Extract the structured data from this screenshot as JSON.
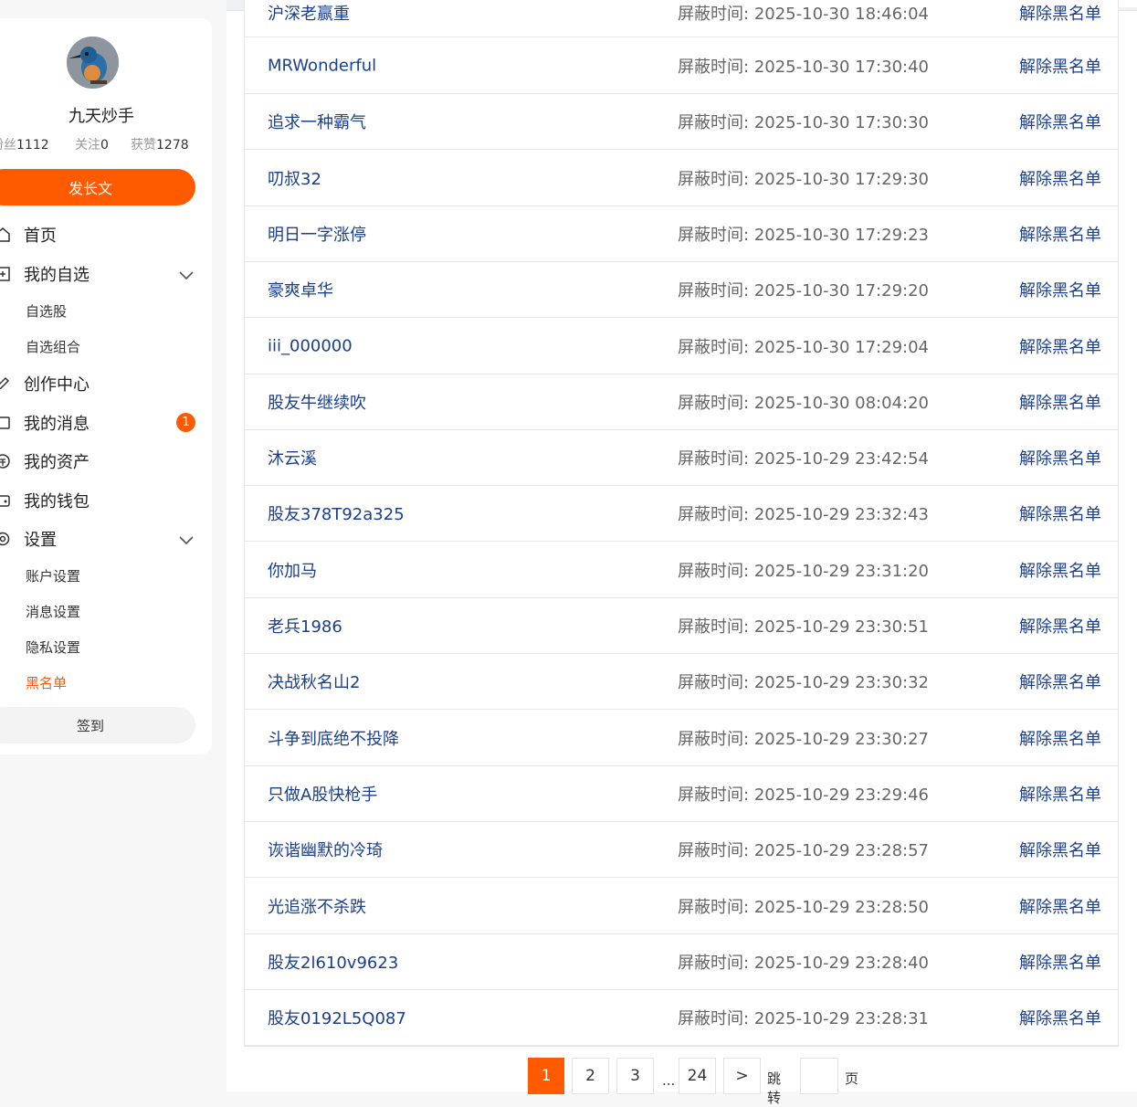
{
  "profile": {
    "name": "九天炒手",
    "fans_label": "粉丝",
    "fans": "1112",
    "follow_label": "关注",
    "follow": "0",
    "likes_label": "获赞",
    "likes": "1278"
  },
  "sidebar": {
    "publish_label": "发长文",
    "home": "首页",
    "watchlist": "我的自选",
    "watchlist_sub": [
      "自选股",
      "自选组合"
    ],
    "creator": "创作中心",
    "messages": "我的消息",
    "messages_badge": "1",
    "assets": "我的资产",
    "wallet": "我的钱包",
    "settings": "设置",
    "settings_sub": [
      "账户设置",
      "消息设置",
      "隐私设置",
      "黑名单"
    ],
    "checkin_label": "签到"
  },
  "blacklist": {
    "time_label": "屏蔽时间:",
    "action_label": "解除黑名单",
    "partial_top": {
      "name": "沪深老赢重",
      "time": "2025-10-30 18:46:04"
    },
    "rows": [
      {
        "name": "MRWonderful",
        "time": "2025-10-30 17:30:40"
      },
      {
        "name": "追求一种霸气",
        "time": "2025-10-30 17:30:30"
      },
      {
        "name": "叨叔32",
        "time": "2025-10-30 17:29:30"
      },
      {
        "name": "明日一字涨停",
        "time": "2025-10-30 17:29:23"
      },
      {
        "name": "豪爽卓华",
        "time": "2025-10-30 17:29:20"
      },
      {
        "name": "iii_000000",
        "time": "2025-10-30 17:29:04"
      },
      {
        "name": "股友牛继续吹",
        "time": "2025-10-30 08:04:20"
      },
      {
        "name": "沐云溪",
        "time": "2025-10-29 23:42:54"
      },
      {
        "name": "股友378T92a325",
        "time": "2025-10-29 23:32:43"
      },
      {
        "name": "你加马",
        "time": "2025-10-29 23:31:20"
      },
      {
        "name": "老兵1986",
        "time": "2025-10-29 23:30:51"
      },
      {
        "name": "决战秋名山2",
        "time": "2025-10-29 23:30:32"
      },
      {
        "name": "斗争到底绝不投降",
        "time": "2025-10-29 23:30:27"
      },
      {
        "name": "只做A股快枪手",
        "time": "2025-10-29 23:29:46"
      },
      {
        "name": "诙谐幽默的冷琦",
        "time": "2025-10-29 23:28:57"
      },
      {
        "name": "光追涨不杀跌",
        "time": "2025-10-29 23:28:50"
      },
      {
        "name": "股友2l610v9623",
        "time": "2025-10-29 23:28:40"
      },
      {
        "name": "股友0192L5Q087",
        "time": "2025-10-29 23:28:31"
      }
    ]
  },
  "pagination": {
    "pages": [
      "1",
      "2",
      "3"
    ],
    "ellipsis": "...",
    "last": "24",
    "next": ">",
    "jump_label": "跳转",
    "page_suffix": "页",
    "current": "1"
  },
  "colors": {
    "accent": "#ff5a00",
    "link": "#1a3f8c"
  }
}
